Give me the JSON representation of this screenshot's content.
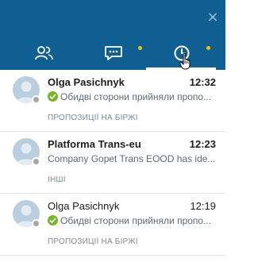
{
  "header": {
    "close_label": "×",
    "tabs": [
      {
        "icon": "contacts-icon",
        "active": false,
        "has_notification": false
      },
      {
        "icon": "chat-bubble-icon",
        "active": false,
        "has_notification": true
      },
      {
        "icon": "clock-history-icon",
        "active": true,
        "has_notification": true
      }
    ],
    "colors": {
      "header_bg": "#0f5f93",
      "notification_dot": "#f2c200",
      "check": "#7bb42d"
    }
  },
  "conversations": [
    {
      "name": "Olga Pasichnyk",
      "time": "12:32",
      "unread": true,
      "preview": "Обидві сторони прийняли пропо...",
      "preview_icon": "check-circle-icon",
      "category": "ПРОПОЗИЦІЇ НА БІРЖІ",
      "status": "offline"
    },
    {
      "name": "Platforma Trans-eu",
      "time": "12:23",
      "unread": true,
      "preview": "Company Gopet Trans EOOD has ide...",
      "preview_icon": "",
      "category": "ІНШІ",
      "status": "offline"
    },
    {
      "name": "Olga Pasichnyk",
      "time": "12:19",
      "unread": false,
      "preview": "Обидві сторони прийняли пропо...",
      "preview_icon": "check-circle-icon",
      "category": "ПРОПОЗИЦІЇ НА БІРЖІ",
      "status": "offline"
    }
  ]
}
